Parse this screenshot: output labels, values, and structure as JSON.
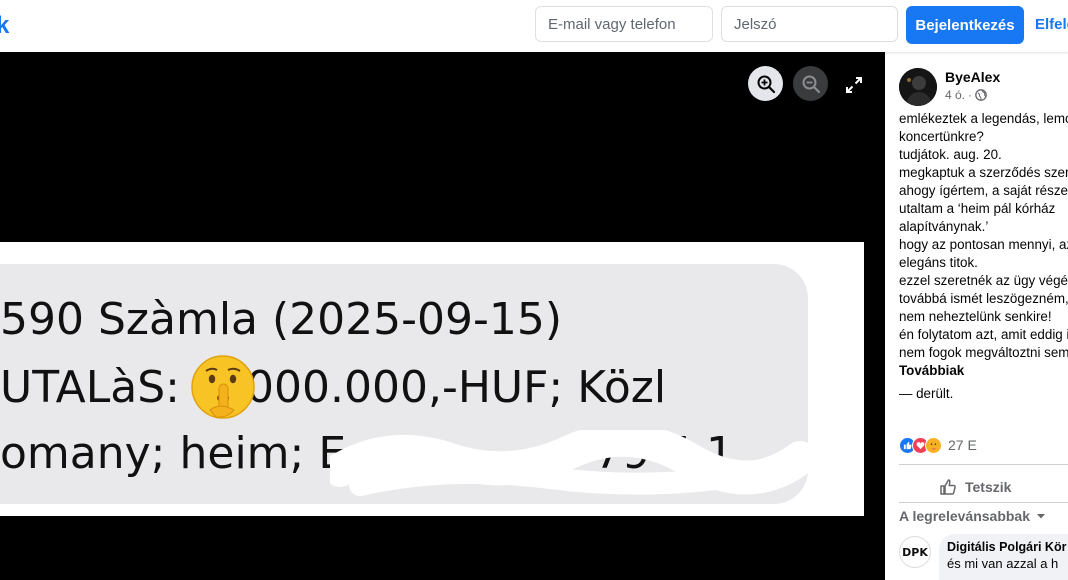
{
  "header": {
    "logo_fragment": "k",
    "email_placeholder": "E-mail vagy telefon",
    "password_placeholder": "Jelszó",
    "login_button": "Bejelentkezés",
    "forgot_link": "Elfelejtetted"
  },
  "viewer": {
    "zoom_in_icon": "magnifier-plus-icon",
    "zoom_out_icon": "magnifier-minus-icon",
    "fullscreen_icon": "expand-icon",
    "photo_lines": [
      "590 Szàmla (2025-09-15)",
      "UTALàS:",
      "000.000,-HUF; Közl",
      "omany; heim; Eg",
      "79 5 1"
    ],
    "emoji": "shushing-face"
  },
  "post": {
    "author": "ByeAlex",
    "time": "4 ó.",
    "privacy_icon": "globe-icon",
    "lines": [
      "emlékeztek a legendás, lemondott",
      "koncertünkre?",
      "tudjátok. aug. 20.",
      "megkaptuk a szerződés szerinti",
      "ahogy ígértem, a saját részemet",
      "utaltam a ‘heim pál kórház",
      "alapítványnak.’",
      "hogy az pontosan mennyi, az",
      "elegáns titok.",
      "ezzel szeretnék az ügy végére",
      "továbbá ismét leszögezném, hogy",
      "nem neheztelünk senkire!",
      "én folytatom azt, amit eddig is",
      "nem fogok megváltoztni semmit"
    ],
    "see_more": "Továbbiak",
    "tail": "— derült.",
    "reaction_count": "27 E",
    "like_label": "Tetszik",
    "sort_label": "A legrelevánsabbak",
    "comment": {
      "avatar_text": "DPK",
      "author": "Digitális Polgári Kör",
      "text": "és mi van azzal a h"
    }
  },
  "colors": {
    "brand_blue": "#1877f2",
    "secondary_text": "#65676b",
    "viewer_bg": "#000000",
    "bubble_gray": "#e9e9eb"
  }
}
